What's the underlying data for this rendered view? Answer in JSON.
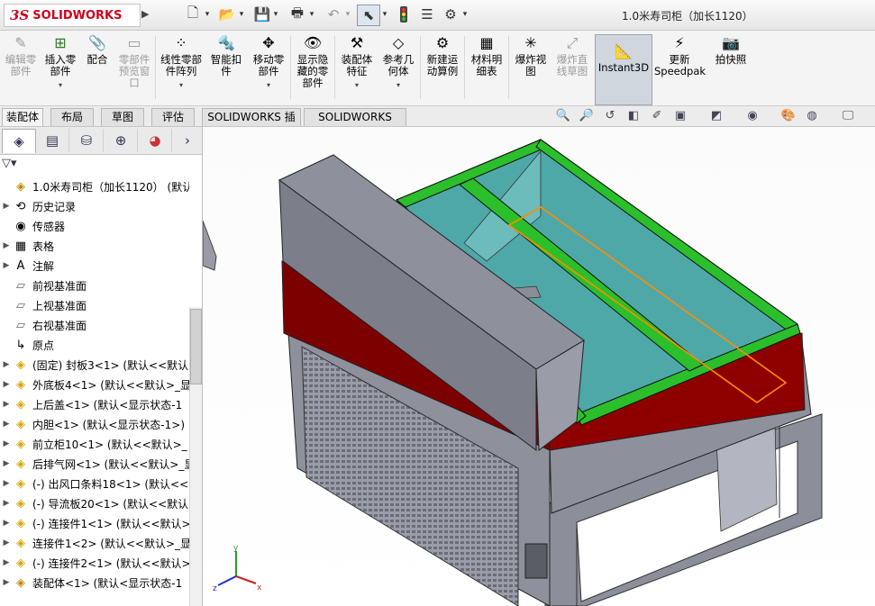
{
  "app": {
    "logo_ds": "3S",
    "logo_text": "SOLIDWORKS",
    "document_title": "1.0米寿司柜（加长1120）"
  },
  "quick_access": [
    {
      "name": "new-file-icon",
      "glyph": "🗋"
    },
    {
      "name": "open-file-icon",
      "glyph": "📂"
    },
    {
      "name": "save-icon",
      "glyph": "💾"
    },
    {
      "name": "print-icon",
      "glyph": "🖶"
    },
    {
      "name": "undo-icon",
      "glyph": "↶"
    },
    {
      "name": "select-icon",
      "glyph": "⬉"
    },
    {
      "name": "rebuild-icon",
      "glyph": "🚦"
    },
    {
      "name": "file-properties-icon",
      "glyph": "☰"
    },
    {
      "name": "options-icon",
      "glyph": "⚙"
    }
  ],
  "commands": [
    {
      "id": "edit-component",
      "label": "编辑零\n部件",
      "glyph": "✎",
      "disabled": true
    },
    {
      "id": "insert-component",
      "label": "插入零\n部件",
      "glyph": "⊞",
      "disabled": false,
      "dropdown": true
    },
    {
      "id": "mate",
      "label": "配合",
      "glyph": "📎",
      "disabled": false
    },
    {
      "id": "component-preview",
      "label": "零部件\n预览窗\n口",
      "glyph": "▭",
      "disabled": true
    },
    {
      "id": "linear-pattern",
      "label": "线性零部\n件阵列",
      "glyph": "⁘",
      "disabled": false,
      "dropdown": true
    },
    {
      "id": "smart-fasteners",
      "label": "智能扣\n件",
      "glyph": "🔩",
      "disabled": false
    },
    {
      "id": "move-component",
      "label": "移动零\n部件",
      "glyph": "✥",
      "disabled": false,
      "dropdown": true
    },
    {
      "id": "show-hidden",
      "label": "显示隐\n藏的零\n部件",
      "glyph": "👁",
      "disabled": false
    },
    {
      "id": "assembly-features",
      "label": "装配体\n特征",
      "glyph": "⚒",
      "disabled": false,
      "dropdown": true
    },
    {
      "id": "reference-geometry",
      "label": "参考几\n何体",
      "glyph": "◇",
      "disabled": false,
      "dropdown": true
    },
    {
      "id": "new-motion-study",
      "label": "新建运\n动算例",
      "glyph": "⚙",
      "disabled": false
    },
    {
      "id": "bill-of-materials",
      "label": "材料明\n细表",
      "glyph": "▦",
      "disabled": false
    },
    {
      "id": "exploded-view",
      "label": "爆炸视\n图",
      "glyph": "✳",
      "disabled": false
    },
    {
      "id": "explode-line-sketch",
      "label": "爆炸直\n线草图",
      "glyph": "⤢",
      "disabled": true
    },
    {
      "id": "instant3d",
      "label": "Instant3D",
      "glyph": "📐",
      "disabled": false,
      "active": true
    },
    {
      "id": "speedpak",
      "label": "更新\nSpeedpak",
      "glyph": "⚡",
      "disabled": false
    },
    {
      "id": "snapshot",
      "label": "拍快照",
      "glyph": "📷",
      "disabled": false
    }
  ],
  "tabs": [
    {
      "label": "装配体",
      "active": true
    },
    {
      "label": "布局",
      "active": false
    },
    {
      "label": "草图",
      "active": false
    },
    {
      "label": "评估",
      "active": false
    },
    {
      "label": "SOLIDWORKS 插件",
      "active": false
    },
    {
      "label": "SOLIDWORKS MBD",
      "active": false
    }
  ],
  "view_toolbar": [
    {
      "name": "zoom-to-fit-icon",
      "glyph": "🔍"
    },
    {
      "name": "zoom-to-area-icon",
      "glyph": "🔎"
    },
    {
      "name": "previous-view-icon",
      "glyph": "↺"
    },
    {
      "name": "section-view-icon",
      "glyph": "◧"
    },
    {
      "name": "dynamic-annotation-icon",
      "glyph": "✐"
    },
    {
      "name": "view-orientation-icon",
      "glyph": "▣"
    },
    {
      "name": "display-style-icon",
      "glyph": "◩"
    },
    {
      "name": "hide-show-items-icon",
      "glyph": "◉"
    },
    {
      "name": "edit-appearance-icon",
      "glyph": "🎨"
    },
    {
      "name": "apply-scene-icon",
      "glyph": "◍"
    },
    {
      "name": "view-settings-icon",
      "glyph": "🖵"
    }
  ],
  "panel_tabs": [
    {
      "name": "feature-manager-tab",
      "glyph": "◈",
      "active": true
    },
    {
      "name": "property-manager-tab",
      "glyph": "▤"
    },
    {
      "name": "configuration-manager-tab",
      "glyph": "⛁"
    },
    {
      "name": "dimxpert-manager-tab",
      "glyph": "⊕"
    },
    {
      "name": "display-manager-tab",
      "glyph": "◕"
    }
  ],
  "tree": {
    "root": "1.0米寿司柜（加长1120）  (默认<...",
    "items": [
      {
        "text": "历史记录",
        "icon": "history",
        "expandable": true
      },
      {
        "text": "传感器",
        "icon": "sensor",
        "expandable": false
      },
      {
        "text": "表格",
        "icon": "table",
        "expandable": true
      },
      {
        "text": "注解",
        "icon": "annotation",
        "expandable": true
      },
      {
        "text": "前视基准面",
        "icon": "plane",
        "expandable": false
      },
      {
        "text": "上视基准面",
        "icon": "plane",
        "expandable": false
      },
      {
        "text": "右视基准面",
        "icon": "plane",
        "expandable": false
      },
      {
        "text": "原点",
        "icon": "origin",
        "expandable": false
      },
      {
        "text": "(固定) 封板3<1> (默认<<默认",
        "icon": "part",
        "expandable": true
      },
      {
        "text": "外底板4<1> (默认<<默认>_显",
        "icon": "part",
        "expandable": true
      },
      {
        "text": "上后盖<1> (默认<显示状态-1",
        "icon": "part",
        "expandable": true
      },
      {
        "text": "内胆<1> (默认<显示状态-1>)",
        "icon": "part",
        "expandable": true
      },
      {
        "text": "前立柜10<1> (默认<<默认>_",
        "icon": "part",
        "expandable": true
      },
      {
        "text": "后排气网<1> (默认<<默认>_显",
        "icon": "part",
        "expandable": true
      },
      {
        "text": "(-) 出风口条料18<1> (默认<<",
        "icon": "part",
        "expandable": true
      },
      {
        "text": "(-) 导流板20<1> (默认<<默认",
        "icon": "part",
        "expandable": true
      },
      {
        "text": "(-) 连接件1<1> (默认<<默认>",
        "icon": "part",
        "expandable": true
      },
      {
        "text": "连接件1<2> (默认<<默认>_显",
        "icon": "part",
        "expandable": true
      },
      {
        "text": "(-) 连接件2<1> (默认<<默认>",
        "icon": "part",
        "expandable": true
      },
      {
        "text": "装配体<1> (默认<显示状态-1",
        "icon": "asm",
        "expandable": true
      }
    ]
  },
  "triad": {
    "x": "x",
    "y": "y",
    "z": "z"
  },
  "colors": {
    "body_gray": "#8e909c",
    "red_band": "#7d0000",
    "green_frame": "#2bbf2b",
    "glass": "#4fa8a8",
    "selection": "#ff8c00"
  }
}
